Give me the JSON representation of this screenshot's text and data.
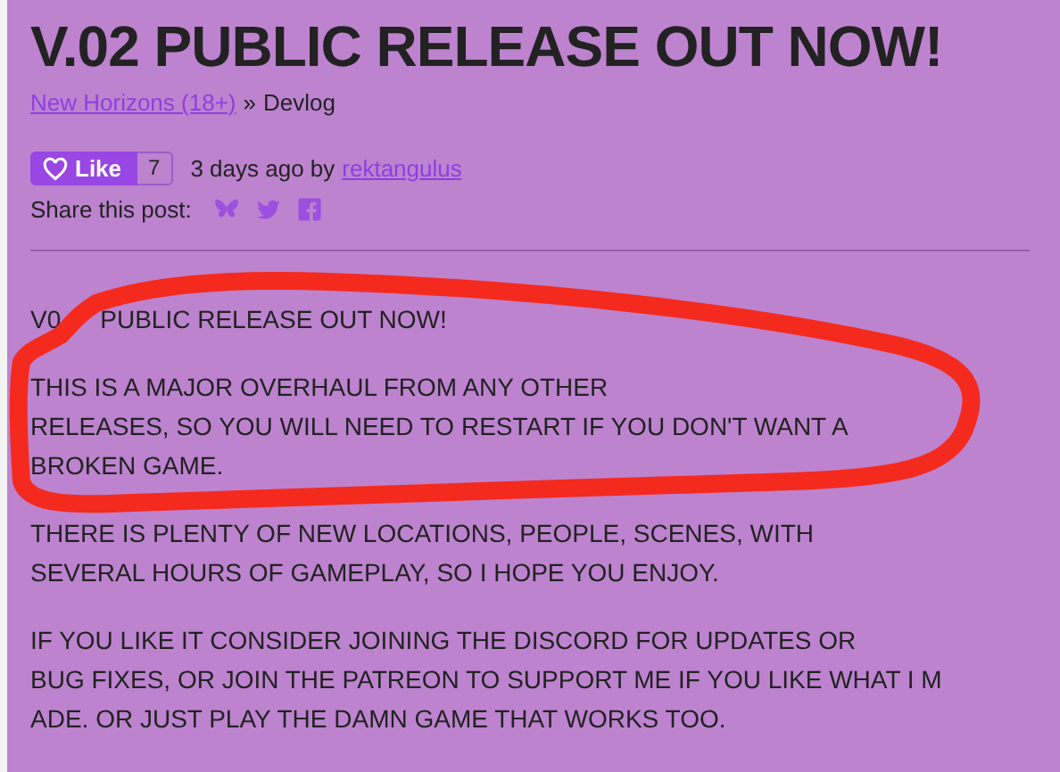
{
  "title": "V.02 PUBLIC RELEASE OUT NOW!",
  "breadcrumb": {
    "link": "New Horizons (18+)",
    "separator": "»",
    "current": "Devlog"
  },
  "like": {
    "label": "Like",
    "count": "7"
  },
  "posted": {
    "text": "3 days ago by",
    "author": "rektangulus"
  },
  "share": {
    "label": "Share this post:"
  },
  "paragraphs": [
    {
      "parts": [
        "V0",
        "PUBLIC RELEASE OUT NOW!"
      ]
    },
    {
      "lines": [
        "THIS IS A MAJOR OVERHAUL FROM ANY OTHER",
        "RELEASES, SO YOU WILL NEED TO RESTART IF YOU DON'T WANT A",
        "BROKEN GAME."
      ]
    },
    {
      "lines": [
        "THERE IS PLENTY OF NEW LOCATIONS, PEOPLE, SCENES, WITH",
        "SEVERAL HOURS OF GAMEPLAY, SO I HOPE YOU ENJOY."
      ]
    },
    {
      "lines": [
        "IF YOU LIKE IT CONSIDER JOINING THE DISCORD FOR UPDATES OR",
        "BUG FIXES, OR JOIN THE PATREON TO SUPPORT ME IF YOU LIKE WHAT I M",
        "ADE. OR JUST PLAY THE DAMN GAME THAT WORKS TOO."
      ]
    }
  ]
}
